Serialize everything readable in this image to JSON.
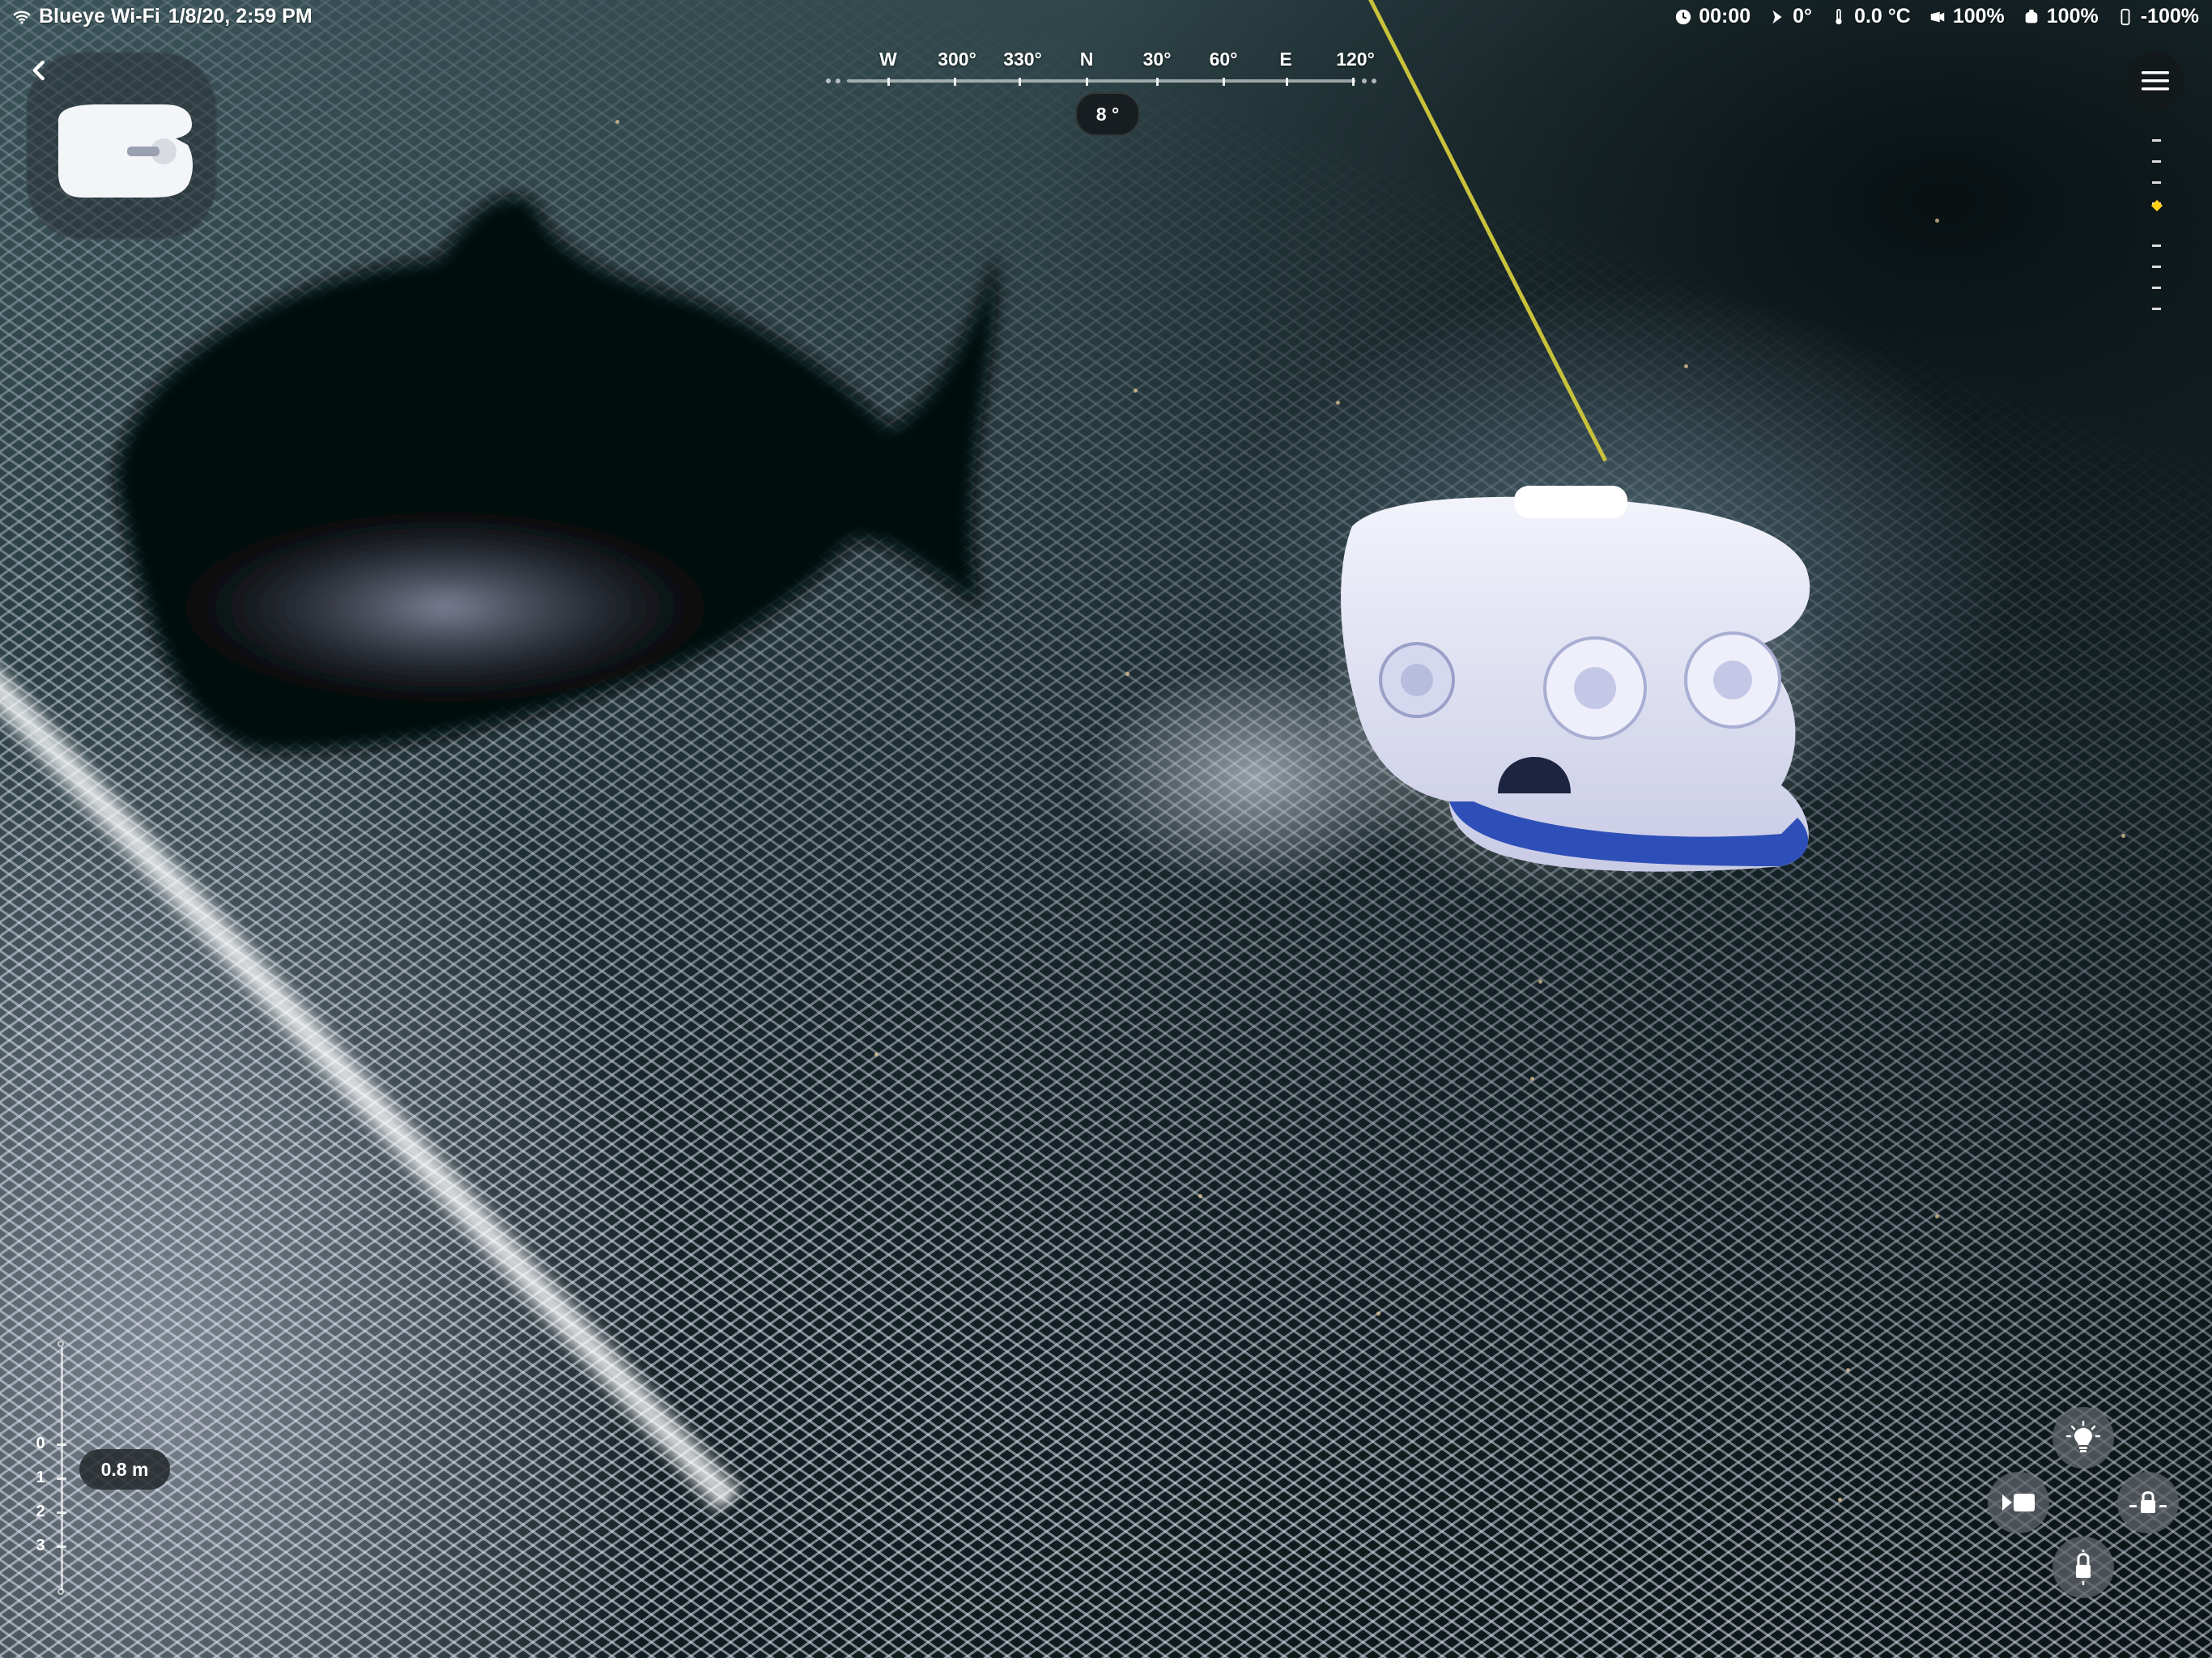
{
  "status_bar": {
    "network": "Blueye Wi-Fi",
    "datetime": "1/8/20, 2:59 PM",
    "timer": "00:00",
    "tilt": "0°",
    "temperature": "0.0 °C",
    "camera_battery": "100%",
    "drone_battery": "100%",
    "device_battery": "-100%"
  },
  "compass": {
    "labels": [
      {
        "text": "W"
      },
      {
        "text": "300°"
      },
      {
        "text": "330°"
      },
      {
        "text": "N"
      },
      {
        "text": "30°"
      },
      {
        "text": "60°"
      },
      {
        "text": "E"
      },
      {
        "text": "120°"
      }
    ],
    "heading": "8 °"
  },
  "depth": {
    "scale_labels": [
      "0",
      "1",
      "2",
      "3"
    ],
    "current": "0.8 m"
  },
  "pitch": {
    "level": 0.36
  },
  "icons": {
    "back": "chevron-left-icon",
    "menu": "hamburger-menu-icon",
    "lights": "light-bulb-icon",
    "record": "video-camera-icon",
    "lock": "lock-icon",
    "unlock": "unlock-icon"
  },
  "colors": {
    "pitch_indicator": "#ffd21a",
    "tether": "#c9c23b"
  }
}
